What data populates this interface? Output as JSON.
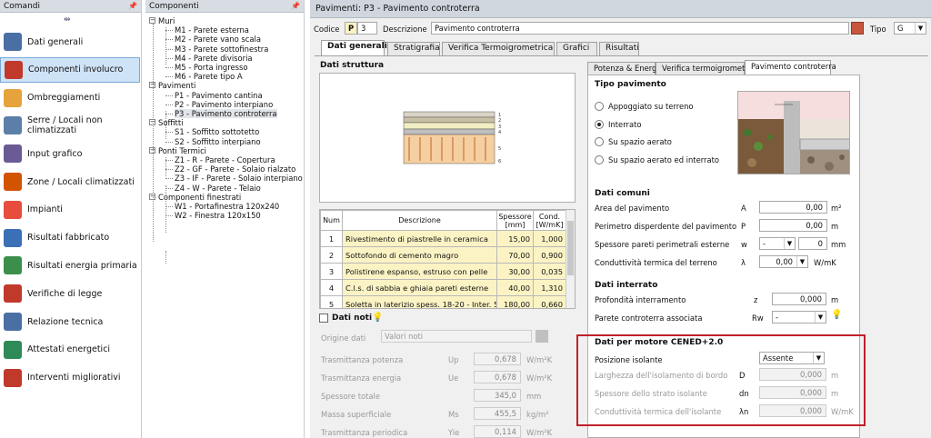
{
  "left": {
    "title": "Comandi",
    "items": [
      {
        "label": "Dati generali",
        "icon": "document-icon"
      },
      {
        "label": "Componenti involucro",
        "icon": "wall-icon"
      },
      {
        "label": "Ombreggiamenti",
        "icon": "shade-icon"
      },
      {
        "label": "Serre / Locali non climatizzati",
        "icon": "greenhouse-icon"
      },
      {
        "label": "Input grafico",
        "icon": "graphic-input-icon"
      },
      {
        "label": "Zone / Locali climatizzati",
        "icon": "house-icon"
      },
      {
        "label": "Impianti",
        "icon": "flame-icon"
      },
      {
        "label": "Risultati fabbricato",
        "icon": "calculator-icon"
      },
      {
        "label": "Risultati energia primaria",
        "icon": "calculator-green-icon"
      },
      {
        "label": "Verifiche di legge",
        "icon": "star-badge-icon"
      },
      {
        "label": "Relazione tecnica",
        "icon": "report-icon"
      },
      {
        "label": "Attestati energetici",
        "icon": "energy-class-icon"
      },
      {
        "label": "Interventi migliorativi",
        "icon": "improvement-icon"
      }
    ]
  },
  "tree": {
    "title": "Componenti",
    "nodes": [
      {
        "label": "Muri",
        "level": 0
      },
      {
        "label": "M1 - Parete esterna",
        "level": 1
      },
      {
        "label": "M2 - Parete vano scala",
        "level": 1
      },
      {
        "label": "M3 - Parete sottofinestra",
        "level": 1
      },
      {
        "label": "M4 - Parete divisoria",
        "level": 1
      },
      {
        "label": "M5 - Porta ingresso",
        "level": 1
      },
      {
        "label": "M6 - Parete tipo A",
        "level": 1
      },
      {
        "label": "Pavimenti",
        "level": 0
      },
      {
        "label": "P1 - Pavimento cantina",
        "level": 1
      },
      {
        "label": "P2 - Pavimento interpiano",
        "level": 1
      },
      {
        "label": "P3 - Pavimento controterra",
        "level": 1,
        "selected": true
      },
      {
        "label": "Soffitti",
        "level": 0
      },
      {
        "label": "S1 - Soffitto sottotetto",
        "level": 1
      },
      {
        "label": "S2 - Soffitto interpiano",
        "level": 1
      },
      {
        "label": "Ponti Termici",
        "level": 0
      },
      {
        "label": "Z1 - R  - Parete - Copertura",
        "level": 1
      },
      {
        "label": "Z2 - GF - Parete - Solaio rialzato",
        "level": 1
      },
      {
        "label": "Z3 - IF - Parete - Solaio interpiano",
        "level": 1
      },
      {
        "label": "Z4 - W  - Parete - Telaio",
        "level": 1
      },
      {
        "label": "Componenti finestrati",
        "level": 0
      },
      {
        "label": "W1 - Portafinestra 120x240",
        "level": 1
      },
      {
        "label": "W2 - Finestra 120x150",
        "level": 1
      }
    ]
  },
  "main": {
    "title": "Pavimenti: P3 - Pavimento controterra",
    "codice_label": "Codice",
    "codice_prefix": "P",
    "codice_value": "3",
    "descrizione_label": "Descrizione",
    "descrizione_value": "Pavimento controterra",
    "tipo_label": "Tipo",
    "tipo_value": "G",
    "tabs": [
      "Dati generali",
      "Stratigrafia",
      "Verifica Termoigrometrica",
      "Grafici",
      "Risultati"
    ],
    "dati_struttura": "Dati struttura",
    "layer_headers": [
      "Num",
      "Descrizione",
      "Spessore [mm]",
      "Cond. [W/mK]"
    ],
    "layers": [
      {
        "num": "1",
        "desc": "Rivestimento di piastrelle in ceramica",
        "sp": "15,00",
        "cond": "1,000"
      },
      {
        "num": "2",
        "desc": "Sottofondo di cemento magro",
        "sp": "70,00",
        "cond": "0,900"
      },
      {
        "num": "3",
        "desc": "Polistirene espanso, estruso con pelle",
        "sp": "30,00",
        "cond": "0,035"
      },
      {
        "num": "4",
        "desc": "C.l.s. di sabbia e ghiaia pareti esterne",
        "sp": "40,00",
        "cond": "1,310"
      },
      {
        "num": "5",
        "desc": "Soletta in laterizio spess. 18-20 - Inter. 50",
        "sp": "180,00",
        "cond": "0,660"
      }
    ],
    "dati_noti": {
      "label": "Dati noti",
      "origine_label": "Origine dati",
      "origine_value": "Valori noti",
      "rows": [
        {
          "label": "Trasmittanza potenza",
          "sym": "Up",
          "val": "0,678",
          "unit": "W/m²K"
        },
        {
          "label": "Trasmittanza energia",
          "sym": "Ue",
          "val": "0,678",
          "unit": "W/m²K"
        },
        {
          "label": "Spessore totale",
          "sym": "",
          "val": "345,0",
          "unit": "mm"
        },
        {
          "label": "Massa superficiale",
          "sym": "Ms",
          "val": "455,5",
          "unit": "kg/m²"
        },
        {
          "label": "Trasmittanza periodica",
          "sym": "Yie",
          "val": "0,114",
          "unit": "W/m²K"
        }
      ]
    },
    "subtabs": [
      "Potenza & Energia",
      "Verifica termoigrometrica",
      "Pavimento controterra"
    ],
    "tipo_pavimento": {
      "title": "Tipo pavimento",
      "options": [
        "Appoggiato su terreno",
        "Interrato",
        "Su spazio aerato",
        "Su spazio aerato ed interrato"
      ],
      "selected": 1
    },
    "dati_comuni": {
      "title": "Dati comuni",
      "rows": [
        {
          "label": "Area del pavimento",
          "sym": "A",
          "val": "0,00",
          "unit": "m²"
        },
        {
          "label": "Perimetro disperdente del pavimento",
          "sym": "P",
          "val": "0,00",
          "unit": "m"
        },
        {
          "label": "Spessore pareti perimetrali esterne",
          "sym": "w",
          "dd": "-",
          "val": "0",
          "unit": "mm"
        },
        {
          "label": "Conduttività termica del terreno",
          "sym": "λ",
          "val": "0,00",
          "unit": "W/mK"
        }
      ]
    },
    "dati_interrato": {
      "title": "Dati interrato",
      "prof_label": "Profondità interramento",
      "prof_sym": "z",
      "prof_val": "0,000",
      "prof_unit": "m",
      "parete_label": "Parete controterra associata",
      "parete_sym": "Rw",
      "parete_val": "-"
    },
    "cened": {
      "title": "Dati per motore CENED+2.0",
      "pos_label": "Posizione isolante",
      "pos_value": "Assente",
      "rows": [
        {
          "label": "Larghezza dell'isolamento di bordo",
          "sym": "D",
          "val": "0,000",
          "unit": "m"
        },
        {
          "label": "Spessore dello strato isolante",
          "sym": "dn",
          "val": "0,000",
          "unit": "m"
        },
        {
          "label": "Conduttività termica dell'isolante",
          "sym": "λn",
          "val": "0,000",
          "unit": "W/mK"
        }
      ]
    }
  }
}
